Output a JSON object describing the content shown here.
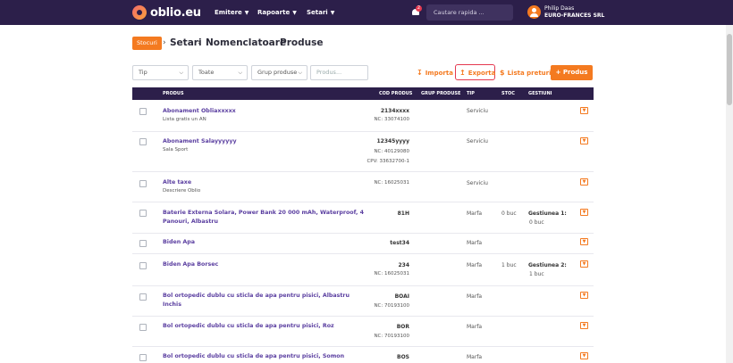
{
  "brand": {
    "name": "oblio.eu"
  },
  "nav": [
    {
      "label": "Emitere"
    },
    {
      "label": "Rapoarte"
    },
    {
      "label": "Setari"
    }
  ],
  "notifications": {
    "count": "2"
  },
  "search": {
    "placeholder": "Cautare rapida ..."
  },
  "user": {
    "name": "Philip Daas",
    "company": "EURO-FRANCES SRL"
  },
  "breadcrumb": {
    "badge": "Stocuri",
    "items": [
      "Setari",
      "Nomenclatoare",
      "Produse"
    ]
  },
  "filters": [
    {
      "label": "Tip",
      "type": "select"
    },
    {
      "label": "Toate",
      "type": "select"
    },
    {
      "label": "Grup produse",
      "type": "select"
    },
    {
      "label": "Produs...",
      "type": "input"
    }
  ],
  "toolbar": {
    "import_label": "Importa",
    "export_label": "Exporta",
    "price_list_label": "Lista preturi",
    "add_label": "Produs"
  },
  "table": {
    "headers": {
      "product": "PRODUS",
      "code": "COD PRODUS",
      "group": "GRUP PRODUSE",
      "type": "TIP",
      "stock": "STOC",
      "management": "GESTIUNI"
    },
    "rows": [
      {
        "name": "Abonament Obliaxxxxx",
        "desc": "Lista gratis un AN",
        "code": "2134xxxx",
        "nc": "NC: 33074100",
        "cpv": "",
        "type": "Serviciu",
        "stock": "",
        "gest": "",
        "gest_qty": ""
      },
      {
        "name": "Abonament Salayyyyyy",
        "desc": "Sala Sport",
        "code": "12345yyyy",
        "nc": "NC: 40129080",
        "cpv": "CPV: 33632700-1",
        "type": "Serviciu",
        "stock": "",
        "gest": "",
        "gest_qty": ""
      },
      {
        "name": "Alte taxe",
        "desc": "Descriere Oblio",
        "code": "",
        "nc": "NC: 16025031",
        "cpv": "",
        "type": "Serviciu",
        "stock": "",
        "gest": "",
        "gest_qty": ""
      },
      {
        "name": "Baterie Externa Solara, Power Bank 20 000 mAh, Waterproof, 4 Panouri, Albastru",
        "desc": "",
        "code": "81H",
        "nc": "",
        "cpv": "",
        "type": "Marfa",
        "stock": "0 buc",
        "gest": "Gestiunea 1:",
        "gest_qty": "0 buc"
      },
      {
        "name": "Biden Apa",
        "desc": "",
        "code": "test34",
        "nc": "",
        "cpv": "",
        "type": "Marfa",
        "stock": "",
        "gest": "",
        "gest_qty": ""
      },
      {
        "name": "Biden Apa Borsec",
        "desc": "",
        "code": "234",
        "nc": "NC: 16025031",
        "cpv": "",
        "type": "Marfa",
        "stock": "1 buc",
        "gest": "Gestiunea 2:",
        "gest_qty": "1 buc"
      },
      {
        "name": "Bol ortopedic dublu cu sticla de apa pentru pisici, Albastru Inchis",
        "desc": "",
        "code": "BOAI",
        "nc": "NC: 70193100",
        "cpv": "",
        "type": "Marfa",
        "stock": "",
        "gest": "",
        "gest_qty": ""
      },
      {
        "name": "Bol ortopedic dublu cu sticla de apa pentru pisici, Roz",
        "desc": "",
        "code": "BOR",
        "nc": "NC: 70193100",
        "cpv": "",
        "type": "Marfa",
        "stock": "",
        "gest": "",
        "gest_qty": ""
      },
      {
        "name": "Bol ortopedic dublu cu sticla de apa pentru pisici, Somon",
        "desc": "",
        "code": "BOS",
        "nc": "",
        "cpv": "",
        "type": "Marfa",
        "stock": "",
        "gest": "",
        "gest_qty": ""
      }
    ]
  },
  "icons": {
    "import": "download-icon",
    "export": "upload-icon",
    "price_list": "dollar-icon",
    "add": "plus-icon",
    "row_action": "dropdown-arrow-icon"
  },
  "colors": {
    "navbar": "#2c1f4a",
    "accent": "#f47a20",
    "link": "#5a3ea0",
    "highlight": "#e53950"
  }
}
